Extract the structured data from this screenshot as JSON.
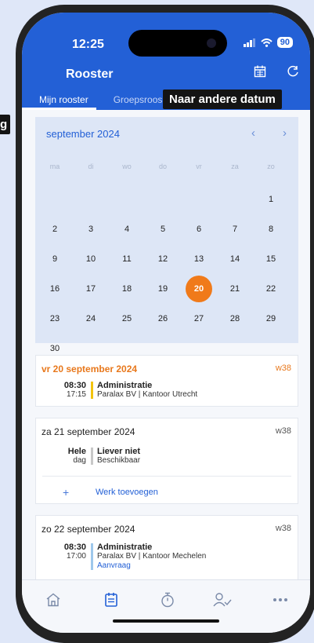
{
  "overlays": {
    "side_tag": "g",
    "tooltip": "Naar andere datum"
  },
  "status": {
    "time": "12:25",
    "battery": "90"
  },
  "header": {
    "title": "Rooster",
    "tabs": [
      "Mijn rooster",
      "Groepsroos"
    ]
  },
  "calendar": {
    "month": "september 2024",
    "weekdays": [
      "ma",
      "di",
      "wo",
      "do",
      "vr",
      "za",
      "zo"
    ],
    "days": [
      "1",
      "2",
      "3",
      "4",
      "5",
      "6",
      "7",
      "8",
      "9",
      "10",
      "11",
      "12",
      "13",
      "14",
      "15",
      "16",
      "17",
      "18",
      "19",
      "20",
      "21",
      "22",
      "23",
      "24",
      "25",
      "26",
      "27",
      "28",
      "29",
      "30"
    ],
    "selected": "20"
  },
  "days": [
    {
      "date": "vr 20 september 2024",
      "week": "w38",
      "highlight": true,
      "entries": [
        {
          "time1": "08:30",
          "time2": "17:15",
          "title": "Administratie",
          "sub": "Paralax BV | Kantoor Utrecht",
          "color": "#f2c40f"
        }
      ]
    },
    {
      "date": "za 21 september 2024",
      "week": "w38",
      "entries": [
        {
          "time1": "Hele",
          "time2": "dag",
          "title": "Liever niet",
          "sub": "Beschikbaar",
          "color": "#c8c8c8"
        }
      ],
      "add_label": "Werk toevoegen"
    },
    {
      "date": "zo 22 september 2024",
      "week": "w38",
      "entries": [
        {
          "time1": "08:30",
          "time2": "17:00",
          "title": "Administratie",
          "sub": "Paralax BV | Kantoor Mechelen",
          "sub2": "Aanvraag",
          "color": "#9ec8ec"
        }
      ]
    }
  ],
  "bottom_nav": [
    "home-icon",
    "schedule-icon",
    "timer-icon",
    "user-check-icon",
    "more-icon"
  ],
  "colors": {
    "primary": "#2360d6",
    "accent": "#f07a1a"
  }
}
